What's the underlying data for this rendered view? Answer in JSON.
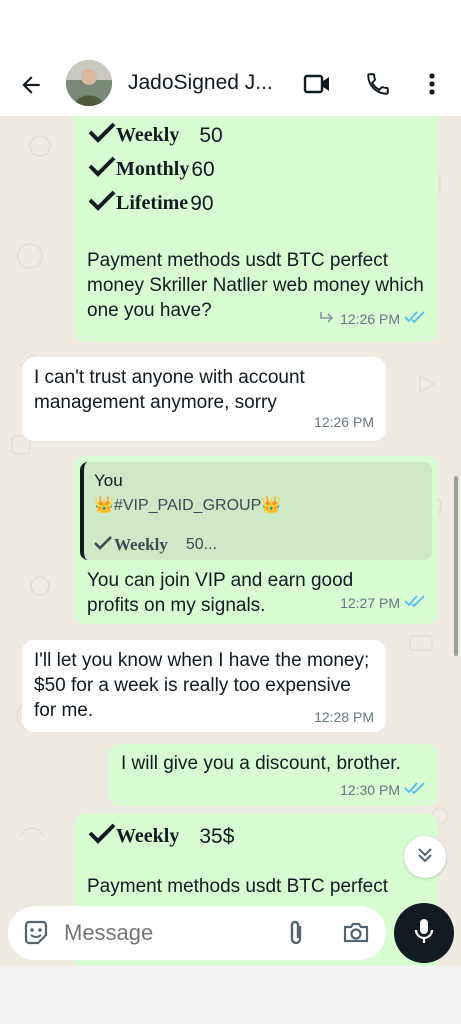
{
  "header": {
    "contact_name": "JadoSigned J...",
    "back_icon": "arrow-left-icon",
    "video_icon": "video-call-icon",
    "call_icon": "phone-icon",
    "menu_icon": "more-vertical-icon"
  },
  "messages": [
    {
      "direction": "outgoing",
      "plans": [
        {
          "label": "Weekly",
          "value": "50"
        },
        {
          "label": "Monthly",
          "value": "60"
        },
        {
          "label": "Lifetime",
          "value": "90"
        }
      ],
      "text": "Payment methods usdt BTC perfect money Skriller Natller web money which one you have?",
      "time": "12:26 PM",
      "forwarded": true,
      "status": "read"
    },
    {
      "direction": "incoming",
      "text": "I can't trust anyone with account management anymore, sorry",
      "time": "12:26 PM"
    },
    {
      "direction": "outgoing",
      "reply": {
        "author": "You",
        "line1": "👑#VIP_PAID_GROUP👑",
        "line2_label": "Weekly",
        "line2_value": "50..."
      },
      "text": "You can join VIP and earn good profits on my signals.",
      "time": "12:27 PM",
      "status": "read"
    },
    {
      "direction": "incoming",
      "text": "I'll let you know when I have the money; $50 for a week is really too expensive for me.",
      "time": "12:28 PM"
    },
    {
      "direction": "outgoing",
      "text": "I will give you a discount, brother.",
      "time": "12:30 PM",
      "status": "read"
    },
    {
      "direction": "outgoing",
      "plans": [
        {
          "label": "Weekly",
          "value": "35$"
        }
      ],
      "text": "Payment methods usdt BTC perfect"
    }
  ],
  "composer": {
    "placeholder": "Message",
    "emoji_icon": "sticker-icon",
    "attach_icon": "paperclip-icon",
    "camera_icon": "camera-icon",
    "mic_icon": "microphone-icon"
  },
  "colors": {
    "outgoing_bubble": "#d9fdd3",
    "incoming_bubble": "#ffffff",
    "chat_background": "#efeae2",
    "read_ticks": "#53bdeb"
  }
}
